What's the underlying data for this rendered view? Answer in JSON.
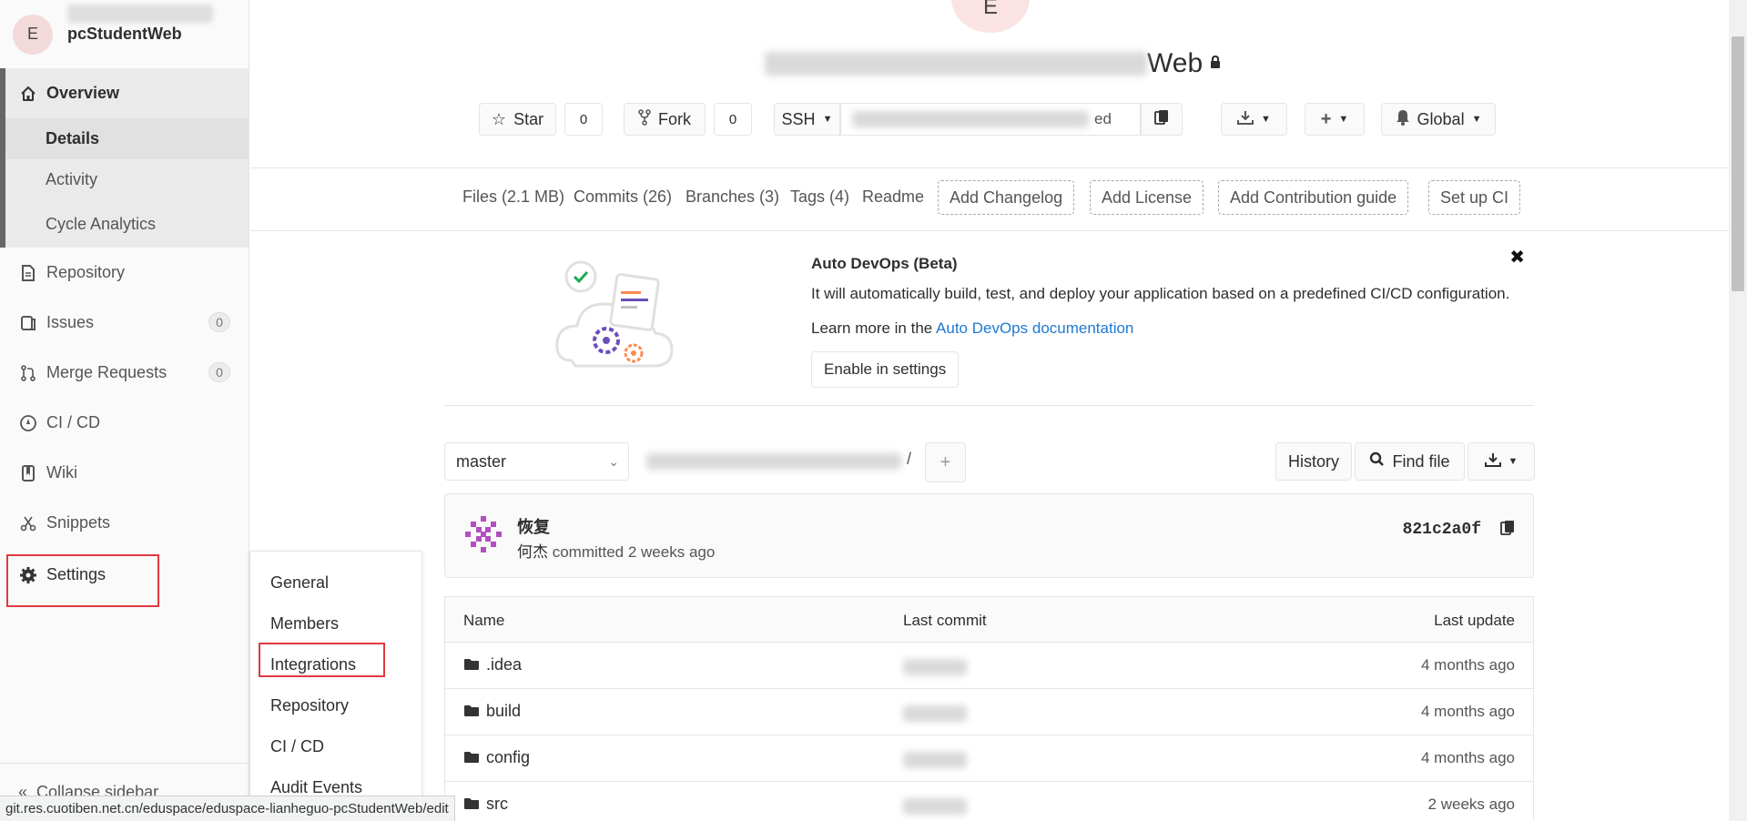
{
  "sidebar": {
    "project_avatar_letter": "E",
    "project_name": "pcStudentWeb",
    "overview": {
      "label": "Overview",
      "icon": "home-icon",
      "children": [
        {
          "label": "Details",
          "active": true
        },
        {
          "label": "Activity",
          "active": false
        },
        {
          "label": "Cycle Analytics",
          "active": false
        }
      ]
    },
    "items": [
      {
        "label": "Repository",
        "icon": "doc-icon"
      },
      {
        "label": "Issues",
        "icon": "issues-icon",
        "count": "0"
      },
      {
        "label": "Merge Requests",
        "icon": "merge-icon",
        "count": "0"
      },
      {
        "label": "CI / CD",
        "icon": "rocket-icon"
      },
      {
        "label": "Wiki",
        "icon": "book-icon"
      },
      {
        "label": "Snippets",
        "icon": "scissors-icon"
      },
      {
        "label": "Settings",
        "icon": "gear-icon"
      }
    ],
    "collapse_label": "Collapse sidebar"
  },
  "settings_flyout": {
    "items": [
      "General",
      "Members",
      "Integrations",
      "Repository",
      "CI / CD",
      "Audit Events"
    ]
  },
  "header": {
    "avatar_letter": "E",
    "title_suffix": "Web",
    "star_label": "Star",
    "star_count": "0",
    "fork_label": "Fork",
    "fork_count": "0",
    "clone_protocol": "SSH",
    "clone_url_tail": "ed",
    "notification_label": "Global"
  },
  "tabs": {
    "files": "Files (2.1 MB)",
    "commits": "Commits (26)",
    "branches": "Branches (3)",
    "tags": "Tags (4)",
    "readme": "Readme",
    "add_changelog": "Add Changelog",
    "add_license": "Add License",
    "add_contribution": "Add Contribution guide",
    "setup_ci": "Set up CI"
  },
  "devops": {
    "title": "Auto DevOps (Beta)",
    "text": "It will automatically build, test, and deploy your application based on a predefined CI/CD configuration.",
    "learn_prefix": "Learn more in the ",
    "learn_link": "Auto DevOps documentation",
    "enable_button": "Enable in settings"
  },
  "branch_bar": {
    "branch": "master",
    "history": "History",
    "find_file": "Find file"
  },
  "last_commit": {
    "title": "恢复",
    "author": "何杰",
    "meta": " committed 2 weeks ago",
    "sha": "821c2a0f"
  },
  "table": {
    "headers": {
      "name": "Name",
      "last_commit": "Last commit",
      "last_update": "Last update"
    },
    "rows": [
      {
        "name": ".idea",
        "updated": "4 months ago"
      },
      {
        "name": "build",
        "updated": "4 months ago"
      },
      {
        "name": "config",
        "updated": "4 months ago"
      },
      {
        "name": "src",
        "updated": "2 weeks ago"
      }
    ]
  },
  "status_url": "git.res.cuotiben.net.cn/eduspace/eduspace-lianheguo-pcStudentWeb/edit",
  "colors": {
    "highlight_box": "#e0393e",
    "link": "#1f78d1"
  }
}
